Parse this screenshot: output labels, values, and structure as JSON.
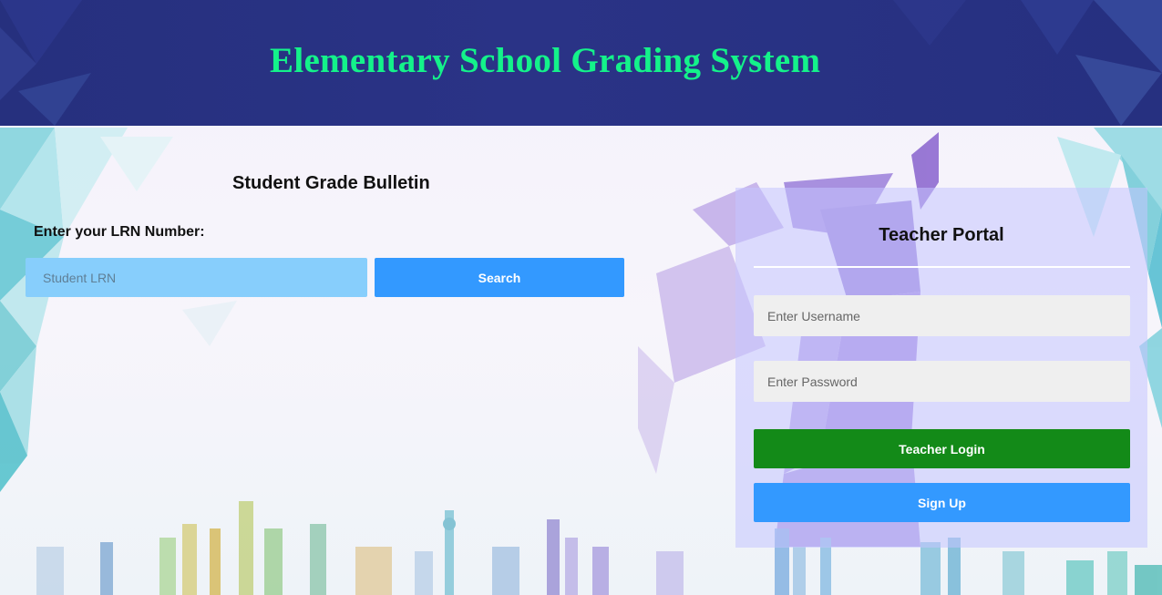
{
  "header": {
    "title": "Elementary School Grading System"
  },
  "student": {
    "section_title": "Student Grade Bulletin",
    "lrn_label": "Enter your LRN Number:",
    "lrn_placeholder": "Student LRN",
    "search_label": "Search"
  },
  "teacher": {
    "portal_title": "Teacher Portal",
    "username_placeholder": "Enter Username",
    "password_placeholder": "Enter Password",
    "login_label": "Teacher Login",
    "signup_label": "Sign Up"
  },
  "colors": {
    "header_bg": "#283183",
    "title_color": "#14f28a",
    "lrn_input_bg": "#87cefc",
    "search_button": "#3399ff",
    "login_button": "#138a18",
    "signup_button": "#3399ff",
    "portal_bg": "#c4c4ff"
  }
}
